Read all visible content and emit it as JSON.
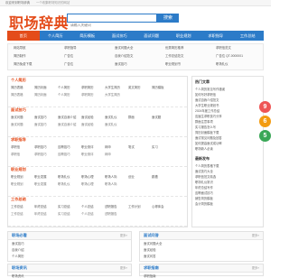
{
  "topbar": {
    "left": "欢迎来到职场辞典",
    "tip": "一个收集职场知识的网站"
  },
  "logo": {
    "text": "职场辞典",
    "sub": "zhichang cidian"
  },
  "search": {
    "placeholder": "请输入关键词",
    "button": "搜索"
  },
  "nav": [
    "首页",
    "个人简历",
    "简历模板",
    "面试技巧",
    "面试问题",
    "职业规划",
    "求职指导",
    "工作总结"
  ],
  "links": [
    [
      "网站导航",
      "求职指导",
      "面试问题大全",
      "优秀简历推荐",
      "求职信范文"
    ],
    [
      "简历制作",
      "广告位",
      "自我介绍范文",
      "工作总结范文",
      "广告位 QT-0000001"
    ],
    [
      "简历免费下载",
      "广告位",
      "面试技巧",
      "职业规划书",
      "职场礼仪"
    ]
  ],
  "categories": [
    {
      "title": "个人简历",
      "items": [
        "简历表格",
        "简历封面",
        "个人简历",
        "求职简历",
        "大学生简历",
        "英文简历",
        "简历模板"
      ]
    },
    {
      "title": "面试技巧",
      "items": [
        "面试问题",
        "面试技巧",
        "面试自我介绍",
        "面试经验",
        "面试礼仪",
        "群面",
        "面试题"
      ]
    },
    {
      "title": "求职指导",
      "items": [
        "求职信",
        "求职技巧",
        "应聘技巧",
        "职业测评",
        "网申",
        "笔试",
        "实习"
      ]
    },
    {
      "title": "职业规划",
      "items": [
        "职业规划",
        "职业发展",
        "职场礼仪",
        "职场心理",
        "职场人际",
        "创业",
        "跳槽"
      ]
    },
    {
      "title": "工作总结",
      "items": [
        "工作总结",
        "年终总结",
        "实习总结",
        "个人总结",
        "述职报告",
        "工作计划",
        "心得体会"
      ]
    }
  ],
  "hot": {
    "heading": "热门文章",
    "items": [
      "个人简历常见写作错误",
      "如何写好求职信",
      "面试自我介绍范文",
      "大学生职业规划书",
      "2024年度工作总结",
      "应届生求职技巧分享",
      "群面注意事项",
      "实习报告怎么写",
      "简历封面模板下载",
      "面试常见问题及回答",
      "如何提高面试成功率",
      "职场新人必读"
    ],
    "heading2": "最新发布",
    "items2": [
      "个人简历表格下载",
      "面试技巧大全",
      "求职信范文精选",
      "职场礼仪常识",
      "年终总结写作",
      "应聘面试技巧",
      "销售简历模板",
      "会计简历模板"
    ]
  },
  "panels": [
    {
      "title": "职场必看",
      "more": "更多»",
      "items": [
        "面试技巧",
        "自我介绍",
        "个人简历"
      ]
    },
    {
      "title": "面试问答",
      "more": "更多»",
      "items": [
        "面试问题大全",
        "面试经验",
        "面试问答"
      ]
    },
    {
      "title": "职场资讯",
      "more": "更多»",
      "items": [
        "职场资讯"
      ]
    },
    {
      "title": "求职指南",
      "more": "更多»",
      "items": [
        "求职指南"
      ]
    }
  ],
  "floaters": [
    "9",
    "6",
    "5"
  ]
}
